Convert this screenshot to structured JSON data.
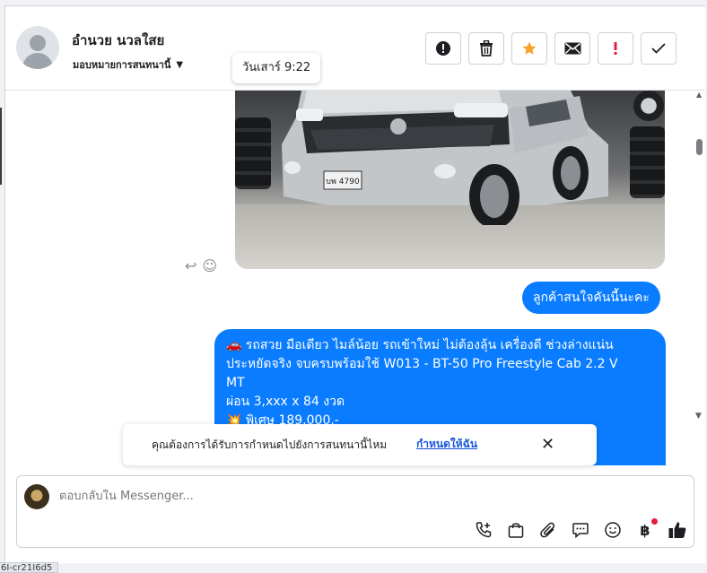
{
  "header": {
    "contact_name": "อำนวย นวลใสย",
    "assign_label": "มอบหมายการสนทนานี้",
    "timestamp_tooltip": "วันเสาร์ 9:22",
    "actions": [
      {
        "name": "spam-button",
        "icon": "exclamation-circle-icon"
      },
      {
        "name": "delete-button",
        "icon": "trash-icon"
      },
      {
        "name": "star-button",
        "icon": "star-icon",
        "color": "#f7a226"
      },
      {
        "name": "mark-unread-button",
        "icon": "envelope-icon"
      },
      {
        "name": "follow-up-button",
        "icon": "exclamation-icon",
        "color": "#e41e3f"
      },
      {
        "name": "mark-done-button",
        "icon": "check-icon"
      }
    ]
  },
  "messages": {
    "short_message": "ลูกค้าสนใจคันนี้นะคะ",
    "long_message_lines": [
      "🚗 รถสวย มือเดียว ไมล์น้อย รถเข้าใหม่ ไม่ต้องลุ้น เครื่องดี ช่วงล่างแน่น",
      "ประหยัดจริง จบครบพร้อมใช้  W013 - BT-50 Pro Freestyle Cab 2.2 V",
      "MT",
      "ผ่อน 3,xxx x 84 งวด",
      "💥 พิเศษ 189,000.-"
    ],
    "plate_text": "บพ 4790",
    "accent_color": "#0a7cff"
  },
  "banner": {
    "text": "คุณต้องการได้รับการกำหนดไปยังการสนทนานี้ไหม",
    "link": "กำหนดให้ฉัน",
    "close": "✕"
  },
  "composer": {
    "placeholder": "ตอบกลับใน Messenger...",
    "tools": [
      "phone-add-icon",
      "shopping-bag-icon",
      "paperclip-icon",
      "saved-reply-icon",
      "emoji-icon",
      "baht-icon",
      "thumbs-up-icon"
    ]
  },
  "status_bar": {
    "text": "6I-cr21I6d5"
  }
}
